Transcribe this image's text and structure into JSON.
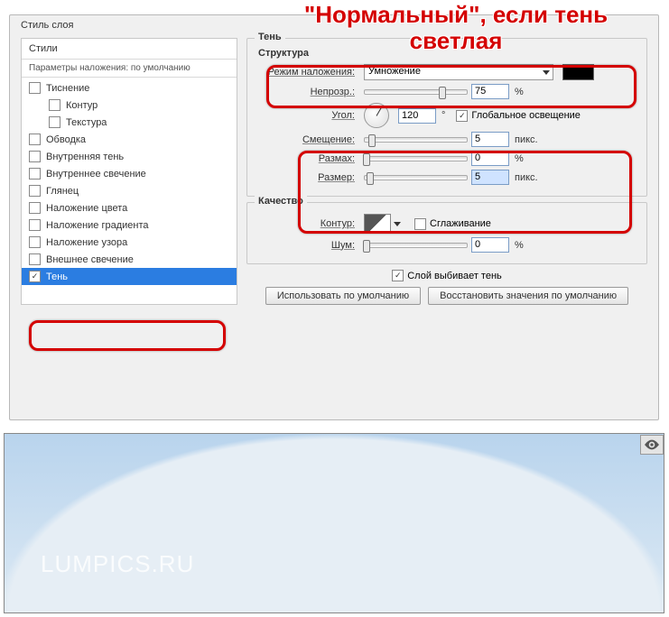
{
  "dialog_title": "Стиль слоя",
  "styles_header": "Стили",
  "params_line": "Параметры наложения: по умолчанию",
  "styles": [
    {
      "label": "Тиснение",
      "checked": false,
      "indent": false
    },
    {
      "label": "Контур",
      "checked": false,
      "indent": true
    },
    {
      "label": "Текстура",
      "checked": false,
      "indent": true
    },
    {
      "label": "Обводка",
      "checked": false,
      "indent": false
    },
    {
      "label": "Внутренняя тень",
      "checked": false,
      "indent": false
    },
    {
      "label": "Внутреннее свечение",
      "checked": false,
      "indent": false
    },
    {
      "label": "Глянец",
      "checked": false,
      "indent": false
    },
    {
      "label": "Наложение цвета",
      "checked": false,
      "indent": false
    },
    {
      "label": "Наложение градиента",
      "checked": false,
      "indent": false
    },
    {
      "label": "Наложение узора",
      "checked": false,
      "indent": false
    },
    {
      "label": "Внешнее свечение",
      "checked": false,
      "indent": false
    },
    {
      "label": "Тень",
      "checked": true,
      "indent": false,
      "selected": true
    }
  ],
  "panel_title": "Тень",
  "structure_title": "Структура",
  "quality_title": "Качество",
  "blend_mode_label": "Режим наложения:",
  "blend_mode_value": "Умножение",
  "opacity_label": "Непрозр.:",
  "opacity_value": "75",
  "opacity_unit": "%",
  "angle_label": "Угол:",
  "angle_value": "120",
  "angle_unit": "°",
  "global_light_label": "Глобальное освещение",
  "distance_label": "Смещение:",
  "distance_value": "5",
  "distance_unit": "пикс.",
  "spread_label": "Размах:",
  "spread_value": "0",
  "spread_unit": "%",
  "size_label": "Размер:",
  "size_value": "5",
  "size_unit": "пикс.",
  "contour_label": "Контур:",
  "antialias_label": "Сглаживание",
  "noise_label": "Шум:",
  "noise_value": "0",
  "noise_unit": "%",
  "knockout_label": "Слой выбивает тень",
  "btn_default": "Использовать по умолчанию",
  "btn_reset": "Восстановить значения по умолчанию",
  "annotation": "\"Нормальный\", если тень светлая",
  "watermark": "LUMPICS.RU"
}
